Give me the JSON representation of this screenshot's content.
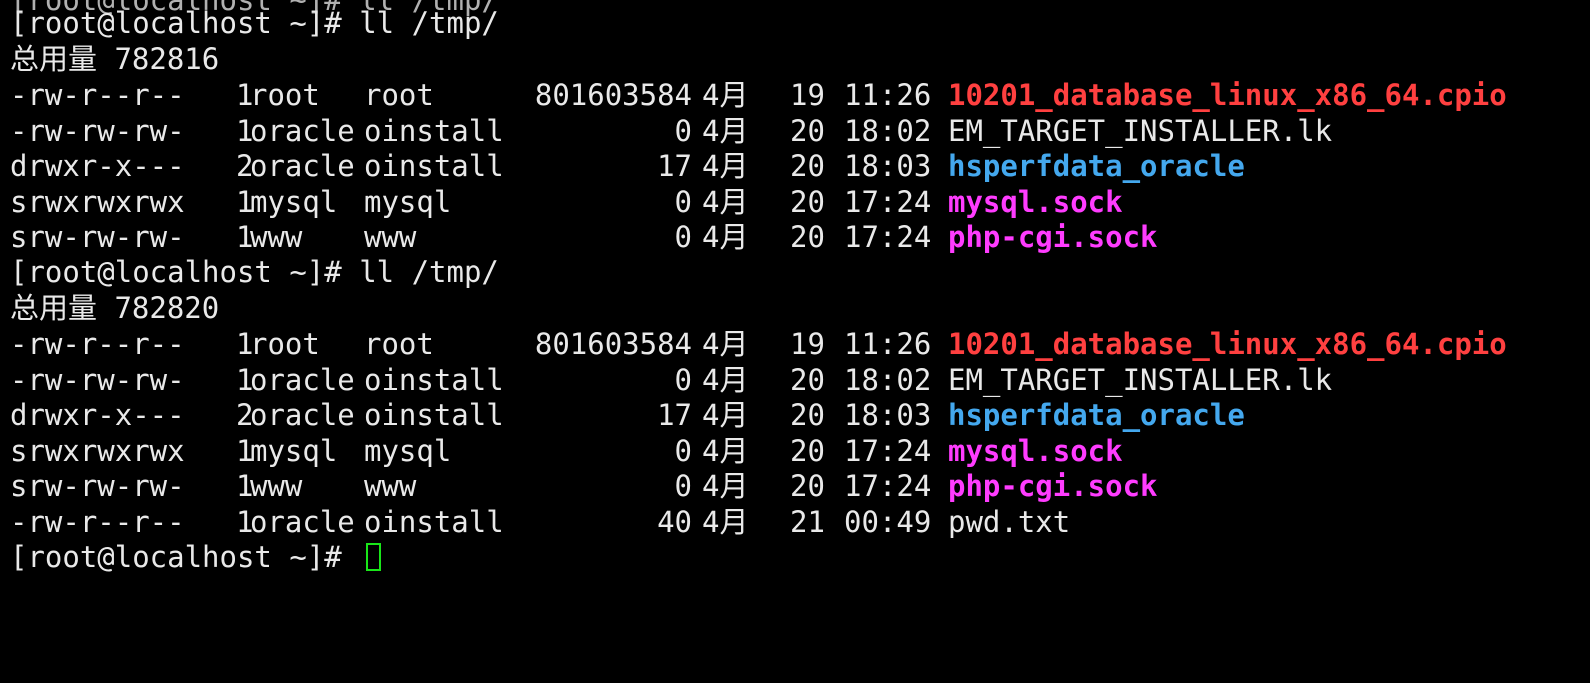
{
  "colors": {
    "background": "#000000",
    "text": "#e9e9e9",
    "red_file": "#ff4040",
    "blue_dir": "#44a8ee",
    "magenta_socket": "#ff3cff",
    "cursor": "#19e619"
  },
  "terminal": {
    "top_fragment": "[root@localhost ~]# ll /tmp/ ",
    "prompt": "[root@localhost ~]# ll /tmp/",
    "total_1": "总用量 782816",
    "total_2": "总用量 782820",
    "final_prompt": "[root@localhost ~]# ",
    "listing_1": [
      {
        "perm": "-rw-r--r--",
        "links": "1",
        "owner": "root",
        "group": "root",
        "size": "801603584",
        "month": "4月",
        "day": "19",
        "time": "11:26",
        "name": "10201_database_linux_x86_64.cpio",
        "color": "#ff4040"
      },
      {
        "perm": "-rw-rw-rw-",
        "links": "1",
        "owner": "oracle",
        "group": "oinstall",
        "size": "0",
        "month": "4月",
        "day": "20",
        "time": "18:02",
        "name": "EM_TARGET_INSTALLER.lk",
        "color": "#e9e9e9"
      },
      {
        "perm": "drwxr-x---",
        "links": "2",
        "owner": "oracle",
        "group": "oinstall",
        "size": "17",
        "month": "4月",
        "day": "20",
        "time": "18:03",
        "name": "hsperfdata_oracle",
        "color": "#44a8ee"
      },
      {
        "perm": "srwxrwxrwx",
        "links": "1",
        "owner": "mysql",
        "group": "mysql",
        "size": "0",
        "month": "4月",
        "day": "20",
        "time": "17:24",
        "name": "mysql.sock",
        "color": "#ff3cff"
      },
      {
        "perm": "srw-rw-rw-",
        "links": "1",
        "owner": "www",
        "group": "www",
        "size": "0",
        "month": "4月",
        "day": "20",
        "time": "17:24",
        "name": "php-cgi.sock",
        "color": "#ff3cff"
      }
    ],
    "listing_2": [
      {
        "perm": "-rw-r--r--",
        "links": "1",
        "owner": "root",
        "group": "root",
        "size": "801603584",
        "month": "4月",
        "day": "19",
        "time": "11:26",
        "name": "10201_database_linux_x86_64.cpio",
        "color": "#ff4040"
      },
      {
        "perm": "-rw-rw-rw-",
        "links": "1",
        "owner": "oracle",
        "group": "oinstall",
        "size": "0",
        "month": "4月",
        "day": "20",
        "time": "18:02",
        "name": "EM_TARGET_INSTALLER.lk",
        "color": "#e9e9e9"
      },
      {
        "perm": "drwxr-x---",
        "links": "2",
        "owner": "oracle",
        "group": "oinstall",
        "size": "17",
        "month": "4月",
        "day": "20",
        "time": "18:03",
        "name": "hsperfdata_oracle",
        "color": "#44a8ee"
      },
      {
        "perm": "srwxrwxrwx",
        "links": "1",
        "owner": "mysql",
        "group": "mysql",
        "size": "0",
        "month": "4月",
        "day": "20",
        "time": "17:24",
        "name": "mysql.sock",
        "color": "#ff3cff"
      },
      {
        "perm": "srw-rw-rw-",
        "links": "1",
        "owner": "www",
        "group": "www",
        "size": "0",
        "month": "4月",
        "day": "20",
        "time": "17:24",
        "name": "php-cgi.sock",
        "color": "#ff3cff"
      },
      {
        "perm": "-rw-r--r--",
        "links": "1",
        "owner": "oracle",
        "group": "oinstall",
        "size": "40",
        "month": "4月",
        "day": "21",
        "time": "00:49",
        "name": "pwd.txt",
        "color": "#e9e9e9"
      }
    ]
  }
}
